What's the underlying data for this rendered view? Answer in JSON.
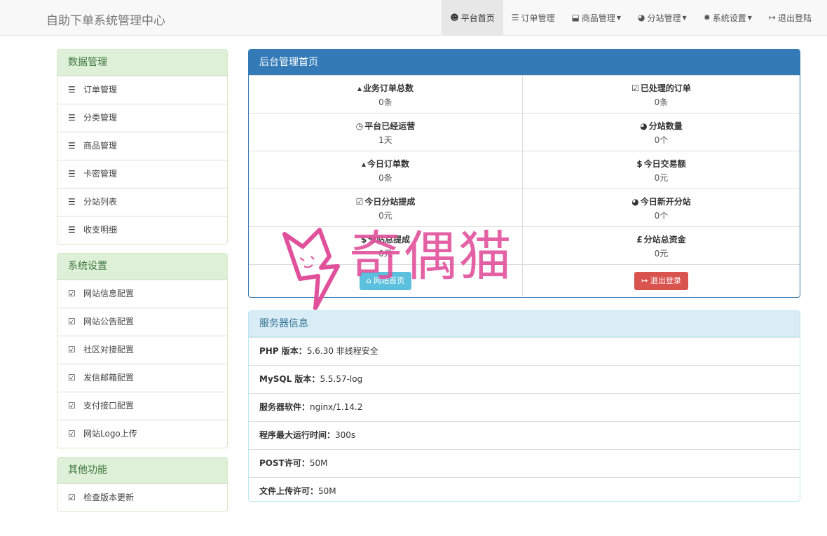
{
  "navbar": {
    "brand": "自助下单系统管理中心",
    "items": [
      {
        "icon": "user-icon",
        "glyph": "☻",
        "label": "平台首页",
        "caret": false,
        "active": true
      },
      {
        "icon": "list-icon",
        "glyph": "☰",
        "label": "订单管理",
        "caret": false,
        "active": false
      },
      {
        "icon": "cart-icon",
        "glyph": "⬓",
        "label": "商品管理",
        "caret": true,
        "active": false
      },
      {
        "icon": "globe-icon",
        "glyph": "◕",
        "label": "分站管理",
        "caret": true,
        "active": false
      },
      {
        "icon": "gear-icon",
        "glyph": "✹",
        "label": "系统设置",
        "caret": true,
        "active": false
      },
      {
        "icon": "logout-icon",
        "glyph": "↦",
        "label": "退出登陆",
        "caret": false,
        "active": false
      }
    ]
  },
  "sidebar": {
    "data_panel": {
      "title": "数据管理",
      "items": [
        "订单管理",
        "分类管理",
        "商品管理",
        "卡密管理",
        "分站列表",
        "收支明细"
      ]
    },
    "settings_panel": {
      "title": "系统设置",
      "items": [
        "网站信息配置",
        "网站公告配置",
        "社区对接配置",
        "发信邮箱配置",
        "支付接口配置",
        "网站Logo上传"
      ]
    },
    "other_panel": {
      "title": "其他功能",
      "items": [
        "检查版本更新"
      ]
    }
  },
  "admin": {
    "title": "后台管理首页",
    "stats": [
      {
        "icon": "drop-icon",
        "glyph": "▴",
        "label": "业务订单总数",
        "value": "0条"
      },
      {
        "icon": "check-square-icon",
        "glyph": "☑",
        "label": "已处理的订单",
        "value": "0条"
      },
      {
        "icon": "clock-icon",
        "glyph": "◷",
        "label": "平台已经运营",
        "value": "1天"
      },
      {
        "icon": "globe-icon",
        "glyph": "◕",
        "label": "分站数量",
        "value": "0个"
      },
      {
        "icon": "drop-icon",
        "glyph": "▴",
        "label": "今日订单数",
        "value": "0条"
      },
      {
        "icon": "dollar-icon",
        "glyph": "$",
        "label": "今日交易额",
        "value": "0元"
      },
      {
        "icon": "check-square-icon",
        "glyph": "☑",
        "label": "今日分站提成",
        "value": "0元"
      },
      {
        "icon": "globe-icon",
        "glyph": "◕",
        "label": "今日新开分站",
        "value": "0个"
      },
      {
        "icon": "dollar-icon",
        "glyph": "$",
        "label": "分站总提成",
        "value": "0元"
      },
      {
        "icon": "pound-icon",
        "glyph": "£",
        "label": "分站总资金",
        "value": "0元"
      }
    ],
    "home_button": "网站首页",
    "logout_button": "退出登录"
  },
  "server": {
    "title": "服务器信息",
    "rows": [
      {
        "label": "PHP 版本：",
        "value": "5.6.30 非线程安全"
      },
      {
        "label": "MySQL 版本：",
        "value": "5.5.57-log"
      },
      {
        "label": "服务器软件：",
        "value": "nginx/1.14.2"
      },
      {
        "label": "程序最大运行时间：",
        "value": "300s"
      },
      {
        "label": "POST许可：",
        "value": "50M"
      },
      {
        "label": "文件上传许可：",
        "value": "50M"
      }
    ]
  },
  "watermark": {
    "text": "奇偶猫"
  },
  "colors": {
    "primary": "#337ab7",
    "success_bg": "#dff0d8",
    "info_bg": "#d9edf7",
    "danger": "#d9534f",
    "info": "#5bc0de",
    "watermark": "#e0509b"
  }
}
